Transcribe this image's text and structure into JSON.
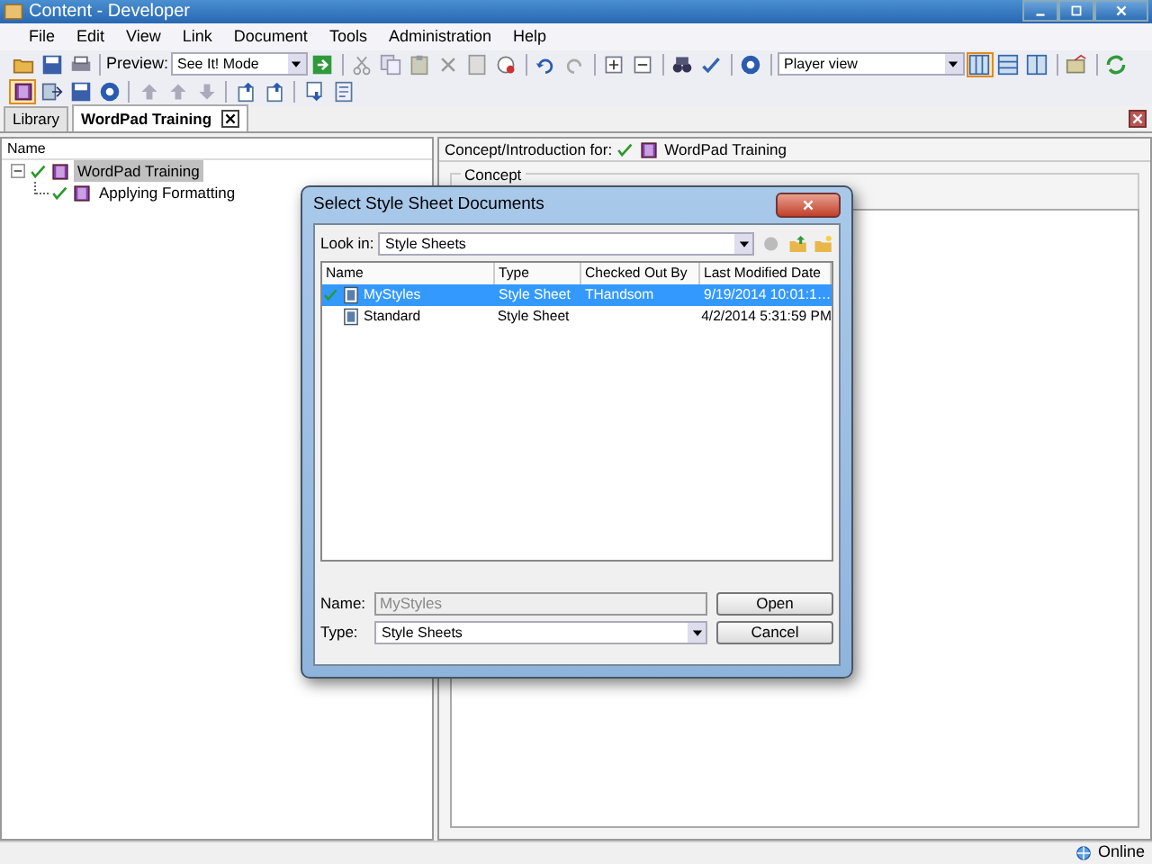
{
  "window": {
    "title": "Content - Developer"
  },
  "menu": [
    "File",
    "Edit",
    "View",
    "Link",
    "Document",
    "Tools",
    "Administration",
    "Help"
  ],
  "toolbar": {
    "preview_label": "Preview:",
    "preview_mode": "See It! Mode",
    "view": "Player view"
  },
  "tabs": [
    {
      "label": "Library",
      "selected": false
    },
    {
      "label": "WordPad Training",
      "selected": true
    }
  ],
  "outline": {
    "header": "Name",
    "tree": [
      {
        "label": "WordPad Training",
        "checked": true,
        "expanded": true,
        "selected": true,
        "children": [
          {
            "label": "Applying Formatting",
            "checked": true,
            "selected": false
          }
        ]
      }
    ]
  },
  "concept": {
    "caption": "Concept/Introduction for:",
    "document": "WordPad Training",
    "checked": true,
    "group_label": "Concept"
  },
  "dialog": {
    "title": "Select Style Sheet Documents",
    "look_in_label": "Look in:",
    "look_in": "Style Sheets",
    "columns": [
      "Name",
      "Type",
      "Checked Out By",
      "Last Modified Date"
    ],
    "rows": [
      {
        "name": "MyStyles",
        "type": "Style Sheet",
        "checked_out_by": "THandsom",
        "modified": "9/19/2014 10:01:1…",
        "checked": true,
        "selected": true
      },
      {
        "name": "Standard",
        "type": "Style Sheet",
        "checked_out_by": "",
        "modified": "4/2/2014 5:31:59 PM",
        "checked": false,
        "selected": false
      }
    ],
    "name_label": "Name:",
    "name_value": "MyStyles",
    "type_label": "Type:",
    "type_value": "Style Sheets",
    "buttons": [
      "Open",
      "Cancel"
    ]
  },
  "status_bar": {
    "status": "Online"
  }
}
